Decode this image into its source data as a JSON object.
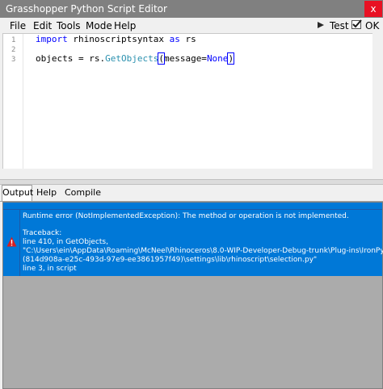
{
  "window": {
    "title": "Grasshopper Python Script Editor",
    "close_glyph": "x"
  },
  "menu": {
    "items": [
      "File",
      "Edit",
      "Tools",
      "Mode",
      "Help"
    ]
  },
  "toolbar": {
    "test": {
      "label": "Test",
      "icon": "play-icon"
    },
    "ok": {
      "label": "OK",
      "icon": "checkmark-icon"
    }
  },
  "editor": {
    "line_numbers": [
      "1",
      "2",
      "3"
    ],
    "line1": {
      "kw1": "import",
      "mid": " rhinoscriptsyntax ",
      "kw2": "as",
      "end": " rs"
    },
    "line3": {
      "a": "objects = rs.",
      "fn": "GetObjects",
      "open": "(",
      "arg": "message=",
      "kw": "None",
      "close": ")"
    }
  },
  "tabs": [
    "Output",
    "Help",
    "Compile"
  ],
  "output": {
    "icon": "error-icon",
    "lines": [
      "Runtime error (NotImplementedException): The method or operation is not implemented.",
      "",
      "Traceback:",
      "  line 410, in GetObjects,",
      "\"C:\\Users\\ein\\AppData\\Roaming\\McNeel\\Rhinoceros\\8.0-WIP-Developer-Debug-trunk\\Plug-ins\\IronPython",
      "(814d908a-e25c-493d-97e9-ee3861957f49)\\settings\\lib\\rhinoscript\\selection.py\"",
      "  line 3, in script"
    ]
  },
  "colors": {
    "selection": "#0078d7",
    "titlebar": "#808080",
    "close": "#e81123",
    "keyword": "#0000ff",
    "function": "#2b91af",
    "error": "#d81e1e"
  }
}
